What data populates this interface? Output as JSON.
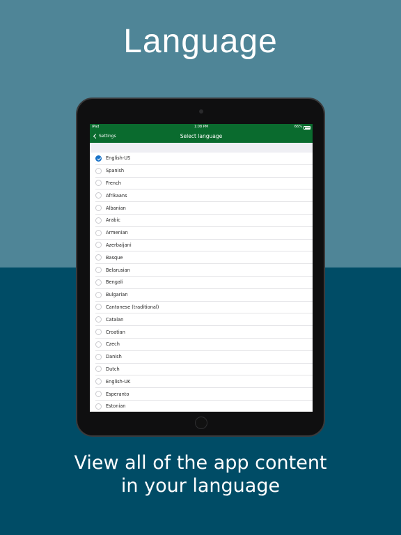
{
  "headline": "Language",
  "tagline": {
    "line1": "View all of the app content",
    "line2": "in your language"
  },
  "device": {
    "status_bar": {
      "carrier": "iPad",
      "time": "1:08 PM",
      "battery": "66%"
    },
    "nav_bar": {
      "back_label": "Settings",
      "title": "Select language"
    },
    "languages": [
      {
        "label": "English-US",
        "selected": true
      },
      {
        "label": "Spanish",
        "selected": false
      },
      {
        "label": "French",
        "selected": false
      },
      {
        "label": "Afrikaans",
        "selected": false
      },
      {
        "label": "Albanian",
        "selected": false
      },
      {
        "label": "Arabic",
        "selected": false
      },
      {
        "label": "Armenian",
        "selected": false
      },
      {
        "label": "Azerbaijani",
        "selected": false
      },
      {
        "label": "Basque",
        "selected": false
      },
      {
        "label": "Belarusian",
        "selected": false
      },
      {
        "label": "Bengali",
        "selected": false
      },
      {
        "label": "Bulgarian",
        "selected": false
      },
      {
        "label": "Cantonese (traditional)",
        "selected": false
      },
      {
        "label": "Catalan",
        "selected": false
      },
      {
        "label": "Croatian",
        "selected": false
      },
      {
        "label": "Czech",
        "selected": false
      },
      {
        "label": "Danish",
        "selected": false
      },
      {
        "label": "Dutch",
        "selected": false
      },
      {
        "label": "English-UK",
        "selected": false
      },
      {
        "label": "Esperanto",
        "selected": false
      },
      {
        "label": "Estonian",
        "selected": false
      }
    ]
  },
  "colors": {
    "bg_top": "#4f8597",
    "bg_bottom": "#004c66",
    "nav_green": "#0a6b2e",
    "checked_blue": "#1a73c8"
  }
}
